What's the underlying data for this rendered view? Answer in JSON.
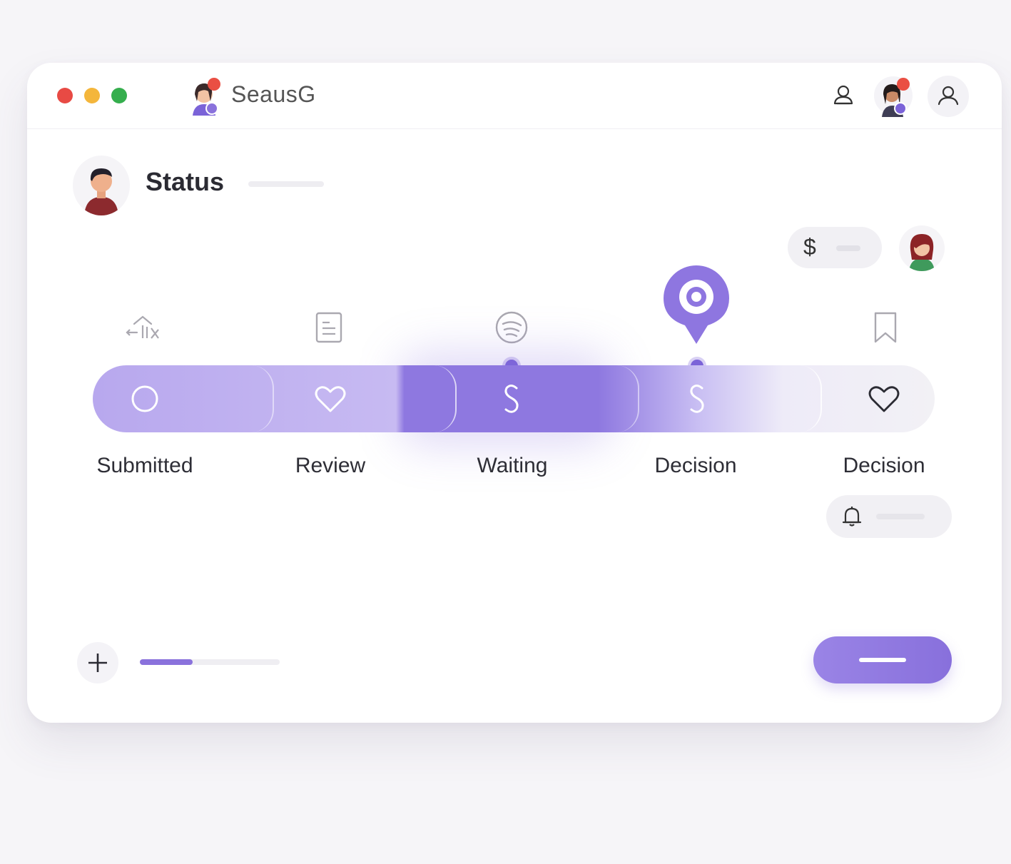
{
  "window": {
    "traffic_lights": [
      "close",
      "minimize",
      "maximize"
    ],
    "app_title": "SeausG"
  },
  "header": {
    "icons": [
      "user-outline-icon",
      "avatar-with-badge",
      "user-circle-icon"
    ]
  },
  "status": {
    "title": "Status",
    "currency_symbol": "$"
  },
  "progress": {
    "steps": [
      {
        "label": "Submitted",
        "icon": "circle-icon",
        "top_icon": "cloud-upload-icon"
      },
      {
        "label": "Review",
        "icon": "heart-icon",
        "top_icon": "document-icon"
      },
      {
        "label": "Waiting",
        "icon": "dollar-s-icon",
        "top_icon": "signal-icon",
        "state": "active"
      },
      {
        "label": "Decision",
        "icon": "dollar-s-icon",
        "top_icon": "location-pin-icon"
      },
      {
        "label": "Decision",
        "icon": "heart-outline-icon",
        "top_icon": "bookmark-icon"
      }
    ],
    "bottom_progress_fraction": 0.38
  },
  "colors": {
    "accent": "#8a72dc",
    "accent_light": "#c7baf2",
    "traffic_red": "#e84a44",
    "traffic_yellow": "#f4b63b",
    "traffic_green": "#35ae4d"
  }
}
